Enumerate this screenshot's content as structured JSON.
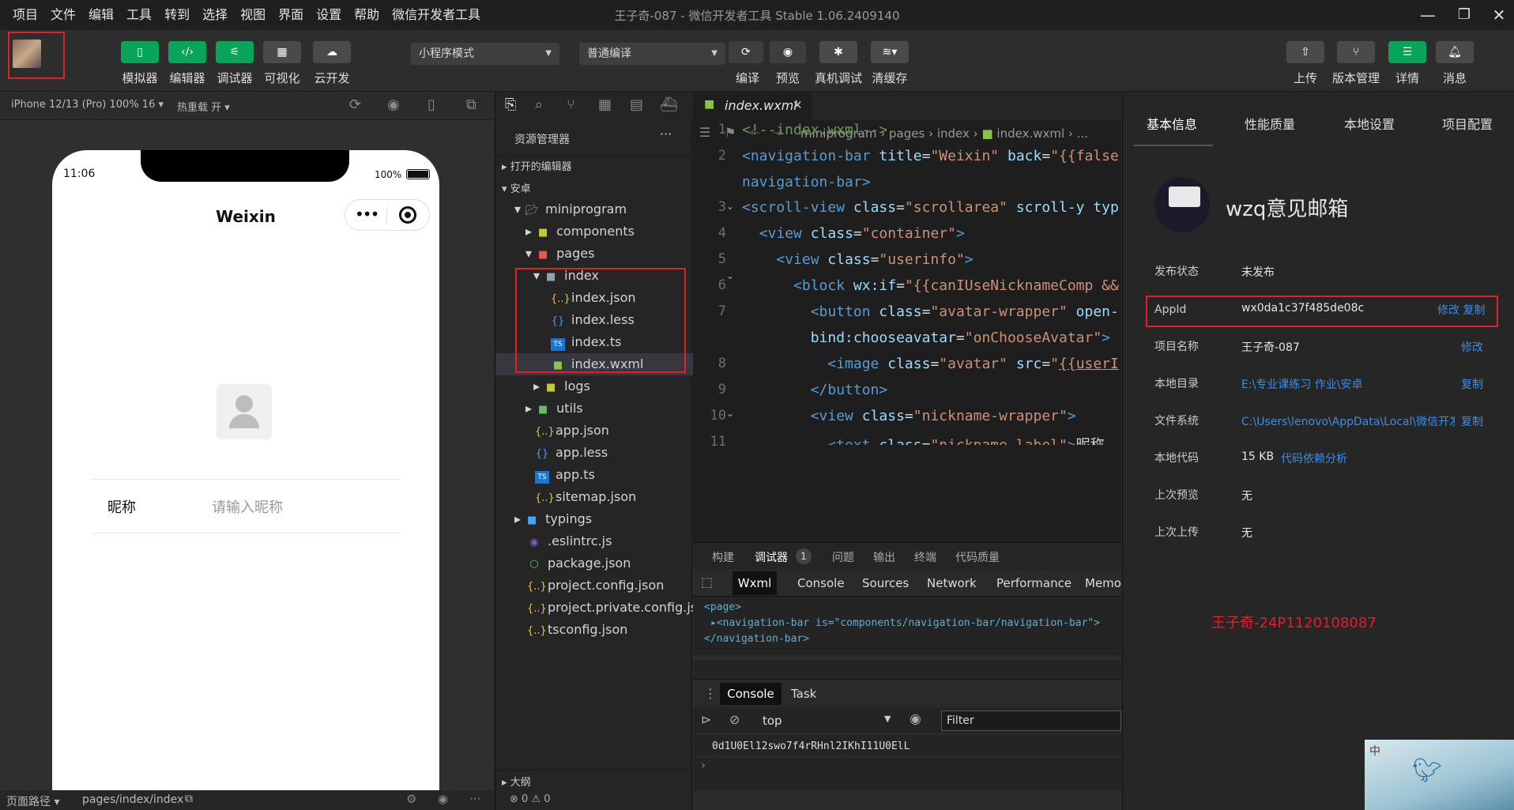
{
  "menu": [
    "项目",
    "文件",
    "编辑",
    "工具",
    "转到",
    "选择",
    "视图",
    "界面",
    "设置",
    "帮助",
    "微信开发者工具"
  ],
  "window_title": "王子奇-087 - 微信开发者工具 Stable 1.06.2409140",
  "toolbar": {
    "left": [
      {
        "label": "模拟器",
        "icon": "phone-icon"
      },
      {
        "label": "编辑器",
        "icon": "code-icon"
      },
      {
        "label": "调试器",
        "icon": "debug-icon"
      },
      {
        "label": "可视化",
        "icon": "layout-icon"
      },
      {
        "label": "云开发",
        "icon": "cloud-icon"
      }
    ],
    "mode_select": "小程序模式",
    "compile_select": "普通编译",
    "middle": [
      {
        "label": "编译",
        "icon": "refresh-icon"
      },
      {
        "label": "预览",
        "icon": "eye-icon"
      },
      {
        "label": "真机调试",
        "icon": "bug-icon"
      },
      {
        "label": "清缓存",
        "icon": "layers-icon"
      }
    ],
    "right": [
      {
        "label": "上传",
        "icon": "upload-icon"
      },
      {
        "label": "版本管理",
        "icon": "branch-icon"
      },
      {
        "label": "详情",
        "icon": "list-icon"
      },
      {
        "label": "消息",
        "icon": "bell-icon"
      }
    ]
  },
  "simulator": {
    "device": "iPhone 12/13 (Pro) 100% 16",
    "hot_reload": "热重载 开",
    "time": "11:06",
    "battery": "100%",
    "nav_title": "Weixin",
    "field_label": "昵称",
    "field_placeholder": "请输入昵称",
    "bottom_path_label": "页面路径",
    "bottom_path": "pages/index/index"
  },
  "explorer": {
    "title": "资源管理器",
    "sections": [
      "打开的编辑器",
      "安卓"
    ],
    "outline": "大纲",
    "problems": "⊗ 0 ⚠ 0",
    "files": [
      {
        "name": "miniprogram",
        "type": "folder-open"
      },
      {
        "name": "components",
        "type": "folder"
      },
      {
        "name": "pages",
        "type": "folder-open"
      },
      {
        "name": "index",
        "type": "folder-open"
      },
      {
        "name": "index.json",
        "type": "json"
      },
      {
        "name": "index.less",
        "type": "less"
      },
      {
        "name": "index.ts",
        "type": "ts"
      },
      {
        "name": "index.wxml",
        "type": "wxml"
      },
      {
        "name": "logs",
        "type": "folder"
      },
      {
        "name": "utils",
        "type": "folder"
      },
      {
        "name": "app.json",
        "type": "json"
      },
      {
        "name": "app.less",
        "type": "less"
      },
      {
        "name": "app.ts",
        "type": "ts"
      },
      {
        "name": "sitemap.json",
        "type": "json"
      },
      {
        "name": "typings",
        "type": "folder"
      },
      {
        "name": ".eslintrc.js",
        "type": "eslint"
      },
      {
        "name": "package.json",
        "type": "node"
      },
      {
        "name": "project.config.json",
        "type": "json"
      },
      {
        "name": "project.private.config.js...",
        "type": "json"
      },
      {
        "name": "tsconfig.json",
        "type": "json"
      }
    ]
  },
  "editor": {
    "tab": "index.wxml",
    "breadcrumb": [
      "miniprogram",
      "pages",
      "index",
      "index.wxml",
      "..."
    ],
    "line_numbers": [
      "1",
      "2",
      "",
      "3",
      "4",
      "5",
      "6",
      "7",
      "",
      "8",
      "9",
      "10",
      "11"
    ]
  },
  "devtools": {
    "top_tabs": [
      "构建",
      "调试器",
      "1",
      "问题",
      "输出",
      "终端",
      "代码质量"
    ],
    "panel_tabs": [
      "Wxml",
      "Console",
      "Sources",
      "Network",
      "Performance",
      "Memor"
    ],
    "wxml_lines": [
      "<page>",
      "▸<navigation-bar is=\"components/navigation-bar/navigation-bar\">",
      "</navigation-bar>"
    ],
    "console_tabs": [
      "Console",
      "Task"
    ],
    "context": "top",
    "filter_placeholder": "Filter",
    "console_output": "0d1U0El12swo7f4rRHnl2IKhI11U0ElL"
  },
  "details": {
    "tabs": [
      "基本信息",
      "性能质量",
      "本地设置",
      "项目配置"
    ],
    "app_name": "wzq意见邮箱",
    "rows": [
      {
        "label": "发布状态",
        "value": "未发布",
        "link": ""
      },
      {
        "label": "AppId",
        "value": "wx0da1c37f485de08c",
        "link": "修改 复制"
      },
      {
        "label": "项目名称",
        "value": "王子奇-087",
        "link": "修改"
      },
      {
        "label": "本地目录",
        "value": "E:\\专业课练习 作业\\安卓",
        "link": "复制"
      },
      {
        "label": "文件系统",
        "value": "C:\\Users\\lenovo\\AppData\\Local\\微信开发者...",
        "link": "复制"
      },
      {
        "label": "本地代码",
        "value": "15 KB",
        "link": "代码依赖分析"
      },
      {
        "label": "上次预览",
        "value": "无",
        "link": ""
      },
      {
        "label": "上次上传",
        "value": "无",
        "link": ""
      }
    ],
    "watermark": "王子奇-24P1120108087"
  },
  "colors": {
    "accent": "#07a45a",
    "link": "#3a8ee6",
    "highlight": "#e0202a"
  }
}
